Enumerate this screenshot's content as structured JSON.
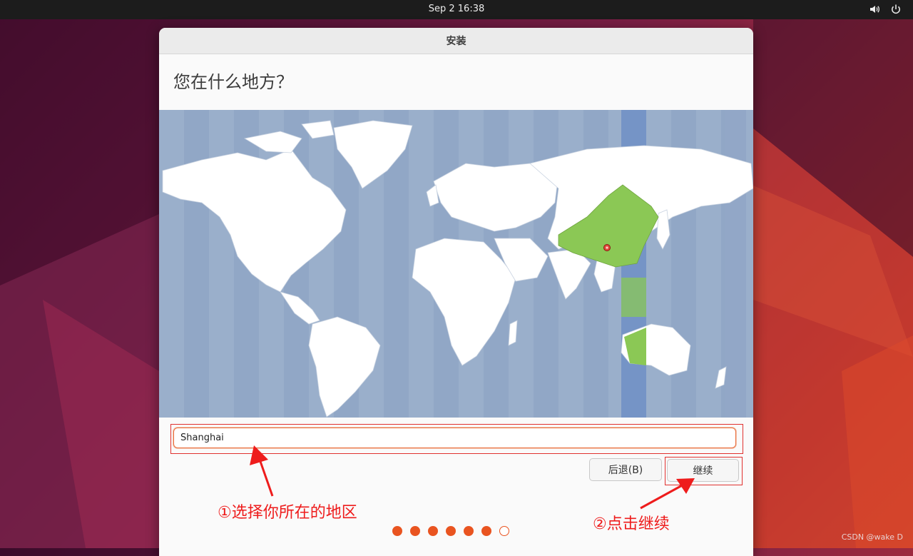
{
  "topbar": {
    "datetime": "Sep 2  16:38",
    "icons": [
      "speaker-icon",
      "power-icon"
    ]
  },
  "window": {
    "title": "安装",
    "heading": "您在什么地方？"
  },
  "map": {
    "selected_region": "China",
    "timezone_highlight": "UTC+8",
    "colors": {
      "ocean": "#9aafcb",
      "land": "#ffffff",
      "selected": "#8bc855",
      "band": "#7594c6",
      "pin": "#e04a3a"
    }
  },
  "location": {
    "value": "Shanghai",
    "placeholder": ""
  },
  "buttons": {
    "back": "后退(B)",
    "continue": "继续"
  },
  "progress": {
    "total_steps": 7,
    "completed_steps": 6
  },
  "annotations": {
    "step1": "①选择你所在的地区",
    "step2": "②点击继续",
    "color": "#ee1c1c"
  },
  "watermark": "CSDN @wake D"
}
